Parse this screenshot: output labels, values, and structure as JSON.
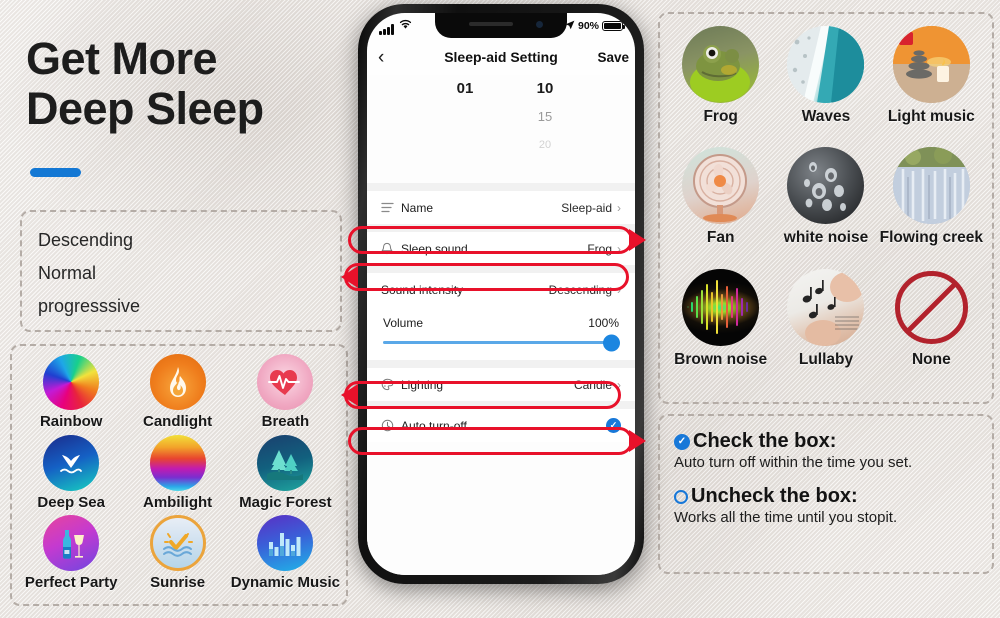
{
  "headline": {
    "text": "Get More\nDeep Sleep",
    "accent_color": "#1478d4"
  },
  "intensity_box": {
    "items": [
      "Descending",
      "Normal",
      "progresssive"
    ]
  },
  "lighting_box": {
    "items": [
      {
        "label": "Rainbow",
        "icon": "rainbow-gradient-icon"
      },
      {
        "label": "Candlight",
        "icon": "flame-icon"
      },
      {
        "label": "Breath",
        "icon": "heartbeat-icon"
      },
      {
        "label": "Deep Sea",
        "icon": "whale-tail-icon"
      },
      {
        "label": "Ambilight",
        "icon": "color-spectrum-icon"
      },
      {
        "label": "Magic Forest",
        "icon": "pine-trees-icon"
      },
      {
        "label": "Perfect Party",
        "icon": "bottle-glass-icon"
      },
      {
        "label": "Sunrise",
        "icon": "sunrise-waves-icon"
      },
      {
        "label": "Dynamic Music",
        "icon": "equalizer-bars-icon"
      }
    ]
  },
  "phone": {
    "statusbar": {
      "signal_icon": "signal-bars-icon",
      "wifi_icon": "wifi-icon",
      "location_icon": "location-arrow-icon",
      "battery_percent": "90%",
      "battery_icon": "battery-icon"
    },
    "navbar": {
      "back_icon": "chevron-left-icon",
      "title": "Sleep-aid Setting",
      "save_label": "Save"
    },
    "time_picker": {
      "hour_values": [
        "01"
      ],
      "minute_values": [
        "10",
        "15",
        "20"
      ]
    },
    "rows": {
      "name": {
        "icon": "list-lines-icon",
        "label": "Name",
        "value": "Sleep-aid",
        "chevron": "›"
      },
      "sleep_sound": {
        "icon": "bell-icon",
        "label": "Sleep sound",
        "value": "Frog",
        "chevron": "›"
      },
      "sound_intensity": {
        "label": "Sound intensity",
        "value": "Descending",
        "chevron": "›"
      },
      "volume": {
        "label": "Volume",
        "value": "100%",
        "slider_percent": 100,
        "track_color": "#5aa8e8",
        "knob_color": "#1c86e0"
      },
      "lighting": {
        "icon": "palette-icon",
        "label": "Lighting",
        "value": "Candle",
        "chevron": "›"
      },
      "auto_turn_off": {
        "icon": "clock-icon",
        "label": "Auto turn-off",
        "checked": true,
        "check_icon": "check-circle-icon",
        "check_color": "#1878d8"
      }
    }
  },
  "annotations": {
    "color": "#e8112a",
    "callouts": [
      {
        "target": "sleep-sound-row",
        "direction": "right"
      },
      {
        "target": "sound-intensity-row",
        "direction": "left"
      },
      {
        "target": "lighting-row",
        "direction": "left"
      },
      {
        "target": "auto-turn-off-row",
        "direction": "right"
      }
    ]
  },
  "sound_box": {
    "items": [
      {
        "label": "Frog",
        "icon": "frog-photo-icon"
      },
      {
        "label": "Waves",
        "icon": "ocean-waves-photo-icon"
      },
      {
        "label": "Light music",
        "icon": "candle-stones-photo-icon"
      },
      {
        "label": "Fan",
        "icon": "electric-fan-photo-icon"
      },
      {
        "label": "white noise",
        "icon": "water-droplets-photo-icon"
      },
      {
        "label": "Flowing creek",
        "icon": "waterfall-photo-icon"
      },
      {
        "label": "Brown noise",
        "icon": "audio-waveform-icon"
      },
      {
        "label": "Lullaby",
        "icon": "baby-music-photo-icon"
      },
      {
        "label": "None",
        "icon": "no-entry-icon"
      }
    ]
  },
  "explain_box": {
    "checked": {
      "icon": "check-circle-filled-icon",
      "heading": "Check the box:",
      "body": "Auto turn off within the time you set."
    },
    "unchecked": {
      "icon": "circle-outline-icon",
      "heading": "Uncheck the box:",
      "body": "Works all the time until you stopit."
    }
  }
}
